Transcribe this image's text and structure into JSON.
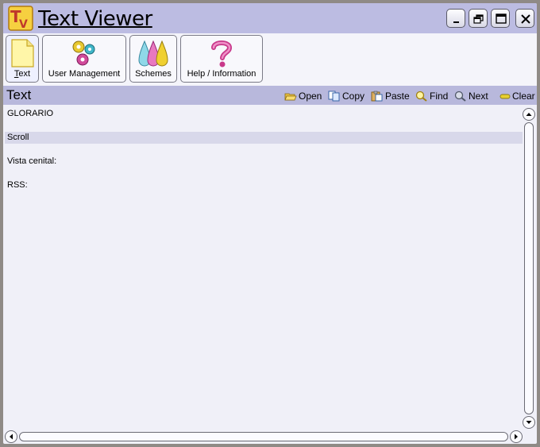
{
  "window": {
    "title": "Text Viewer",
    "logo_letters": "TV",
    "controls": [
      "minimize-icon",
      "restore-icon",
      "maximize-icon",
      "close-icon"
    ]
  },
  "toolbar": {
    "items": [
      {
        "label": "Text",
        "mnemonic": "T",
        "icon": "document-icon",
        "active": true
      },
      {
        "label": "User Management",
        "mnemonic": "U",
        "icon": "gears-icon"
      },
      {
        "label": "Schemes",
        "mnemonic": "S",
        "icon": "color-drops-icon"
      },
      {
        "label": "Help / Information",
        "mnemonic": "H",
        "icon": "question-icon"
      }
    ]
  },
  "section": {
    "title": "Text",
    "actions": [
      {
        "label": "Open",
        "icon": "folder-open-icon"
      },
      {
        "label": "Copy",
        "icon": "copy-icon"
      },
      {
        "label": "Paste",
        "icon": "paste-icon"
      },
      {
        "label": "Find",
        "icon": "magnifier-icon"
      },
      {
        "label": "Next",
        "icon": "find-next-icon"
      },
      {
        "label": "Clear",
        "icon": "eraser-icon"
      }
    ]
  },
  "content": {
    "lines": [
      "GLORARIO",
      "",
      "Scroll",
      "",
      "Vista cenital:",
      "",
      "RSS:"
    ],
    "highlighted_line": 2
  },
  "colors": {
    "titlebar": "#bcbce2",
    "header": "#b8b8dc",
    "background": "#f0f0f8",
    "highlight": "#d8d8ea",
    "frame": "#8f8a86"
  }
}
